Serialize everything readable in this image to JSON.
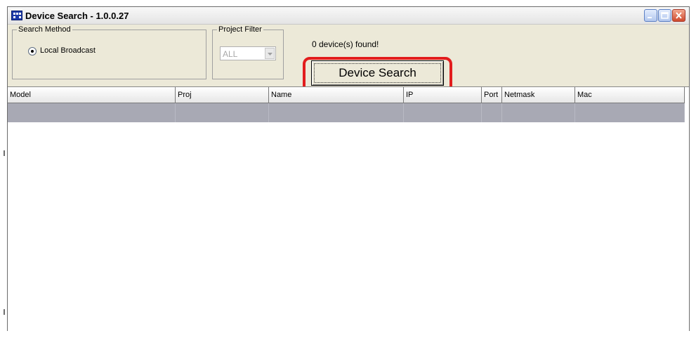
{
  "window": {
    "title": "Device Search - 1.0.0.27"
  },
  "search_method": {
    "label": "Search Method",
    "option_label": "Local Broadcast",
    "selected": true
  },
  "project_filter": {
    "label": "Project Filter",
    "value": "ALL"
  },
  "status": {
    "found_text": "0 device(s) found!"
  },
  "actions": {
    "search_label": "Device Search"
  },
  "table": {
    "columns": [
      "Model",
      "Proj",
      "Name",
      "IP",
      "Port",
      "Netmask",
      "Mac"
    ],
    "rows": [
      [
        "",
        "",
        "",
        "",
        "",
        "",
        ""
      ]
    ]
  },
  "icons": {
    "app": "grid-app-icon",
    "minimize": "minimize-icon",
    "maximize": "maximize-icon",
    "close": "close-icon",
    "dropdown": "chevron-down-icon"
  },
  "colors": {
    "highlight": "#e21d1d",
    "selected_row": "#a8a9b4",
    "titlebar_icon": "#1c3aa8"
  }
}
